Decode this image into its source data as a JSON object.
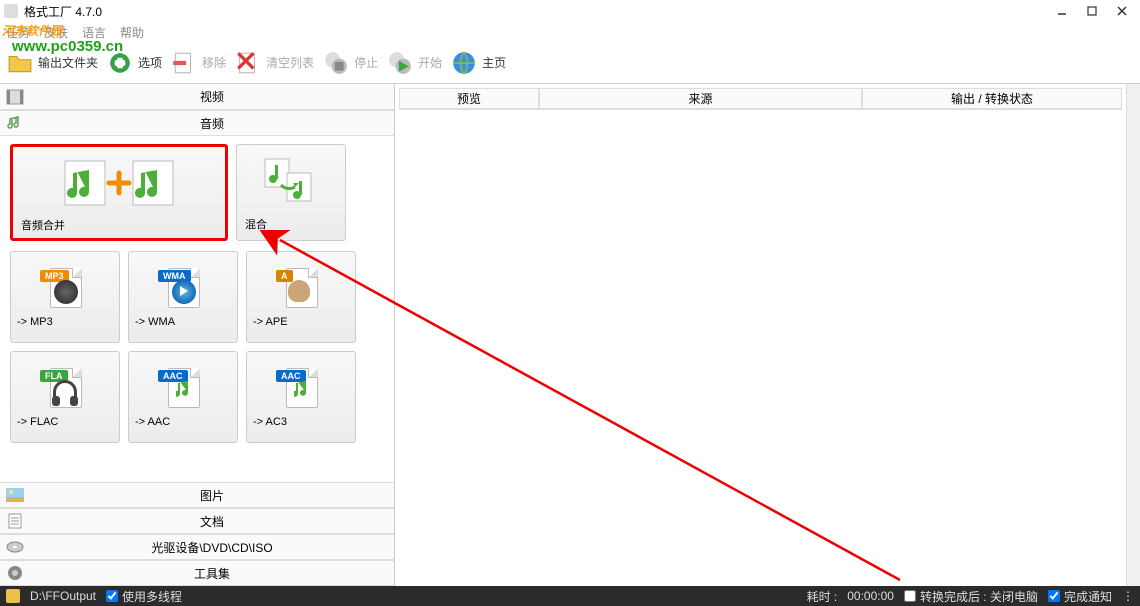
{
  "window": {
    "title": "格式工厂 4.7.0"
  },
  "menubar": {
    "items": [
      "任务",
      "皮肤",
      "语言",
      "帮助"
    ]
  },
  "toolbar": {
    "output_folder": "输出文件夹",
    "options": "选项",
    "remove": "移除",
    "clear_list": "清空列表",
    "stop": "停止",
    "start": "开始",
    "home": "主页"
  },
  "categories": {
    "video": "视频",
    "audio": "音频",
    "picture": "图片",
    "document": "文档",
    "drive": "光驱设备\\DVD\\CD\\ISO",
    "tools": "工具集"
  },
  "audio_tiles": {
    "merge": "音频合并",
    "mix": "混合",
    "formats": [
      {
        "label": "-> MP3",
        "badge": "MP3",
        "badge_color": "#f08c00",
        "style": "speaker"
      },
      {
        "label": "-> WMA",
        "badge": "WMA",
        "badge_color": "#0a6acb",
        "style": "play"
      },
      {
        "label": "-> APE",
        "badge": "A",
        "badge_color": "#d88400",
        "style": "ape"
      },
      {
        "label": "-> FLAC",
        "badge": "FLA",
        "badge_color": "#3aa63a",
        "style": "headphones"
      },
      {
        "label": "-> AAC",
        "badge": "AAC",
        "badge_color": "#0a6acb",
        "style": "note"
      },
      {
        "label": "-> AC3",
        "badge": "AAC",
        "badge_color": "#0a6acb",
        "style": "note"
      }
    ]
  },
  "list_columns": {
    "preview": "预览",
    "source": "来源",
    "output": "输出 / 转换状态"
  },
  "statusbar": {
    "output_path": "D:\\FFOutput",
    "multithread": "使用多线程",
    "elapsed_prefix": "耗时 :",
    "elapsed_time": "00:00:00",
    "shutdown_after": "转换完成后 : 关闭电脑",
    "finish_notify": "完成通知"
  },
  "watermark": {
    "site_name": "河东软件园",
    "url": "www.pc0359.cn"
  }
}
